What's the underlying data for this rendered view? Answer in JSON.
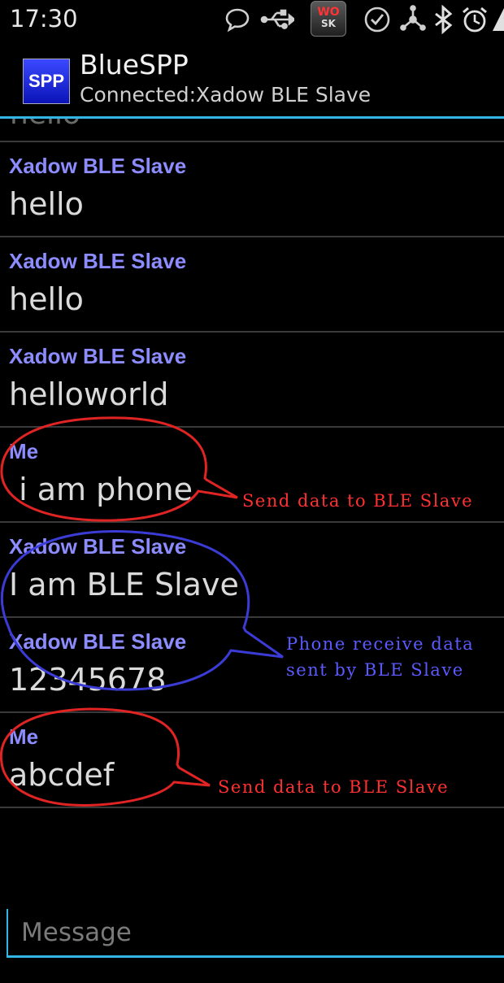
{
  "status_bar": {
    "time": "17:30",
    "icons": [
      "chat-bubble-icon",
      "usb-icon",
      "wo-app-icon",
      "check-circle-icon",
      "share-icon",
      "bluetooth-icon",
      "alarm-icon",
      "signal-icon"
    ],
    "wo_badge_top": "WO",
    "wo_badge_bottom": "SK"
  },
  "action_bar": {
    "logo_text": "SPP",
    "title": "BlueSPP",
    "subtitle": "Connected:Xadow BLE Slave",
    "accent": "#33b5e5"
  },
  "chat": {
    "partial_previous": "hello",
    "messages": [
      {
        "sender": "Xadow BLE Slave",
        "text": "hello"
      },
      {
        "sender": "Xadow BLE Slave",
        "text": "hello"
      },
      {
        "sender": "Xadow BLE Slave",
        "text": "helloworld"
      },
      {
        "sender": "Me",
        "text": " i am phone"
      },
      {
        "sender": "Xadow BLE Slave",
        "text": "I am BLE Slave"
      },
      {
        "sender": "Xadow BLE Slave",
        "text": "12345678"
      },
      {
        "sender": "Me",
        "text": "abcdef"
      }
    ],
    "sender_color": "#8c8cff"
  },
  "annotations": {
    "send_1": "Send data to BLE Slave",
    "receive": "Phone receive data\nsent by BLE Slave",
    "send_2": "Send data to BLE Slave",
    "red": "#ff3030",
    "blue": "#3b3bd6"
  },
  "compose": {
    "placeholder": "Message",
    "value": ""
  }
}
